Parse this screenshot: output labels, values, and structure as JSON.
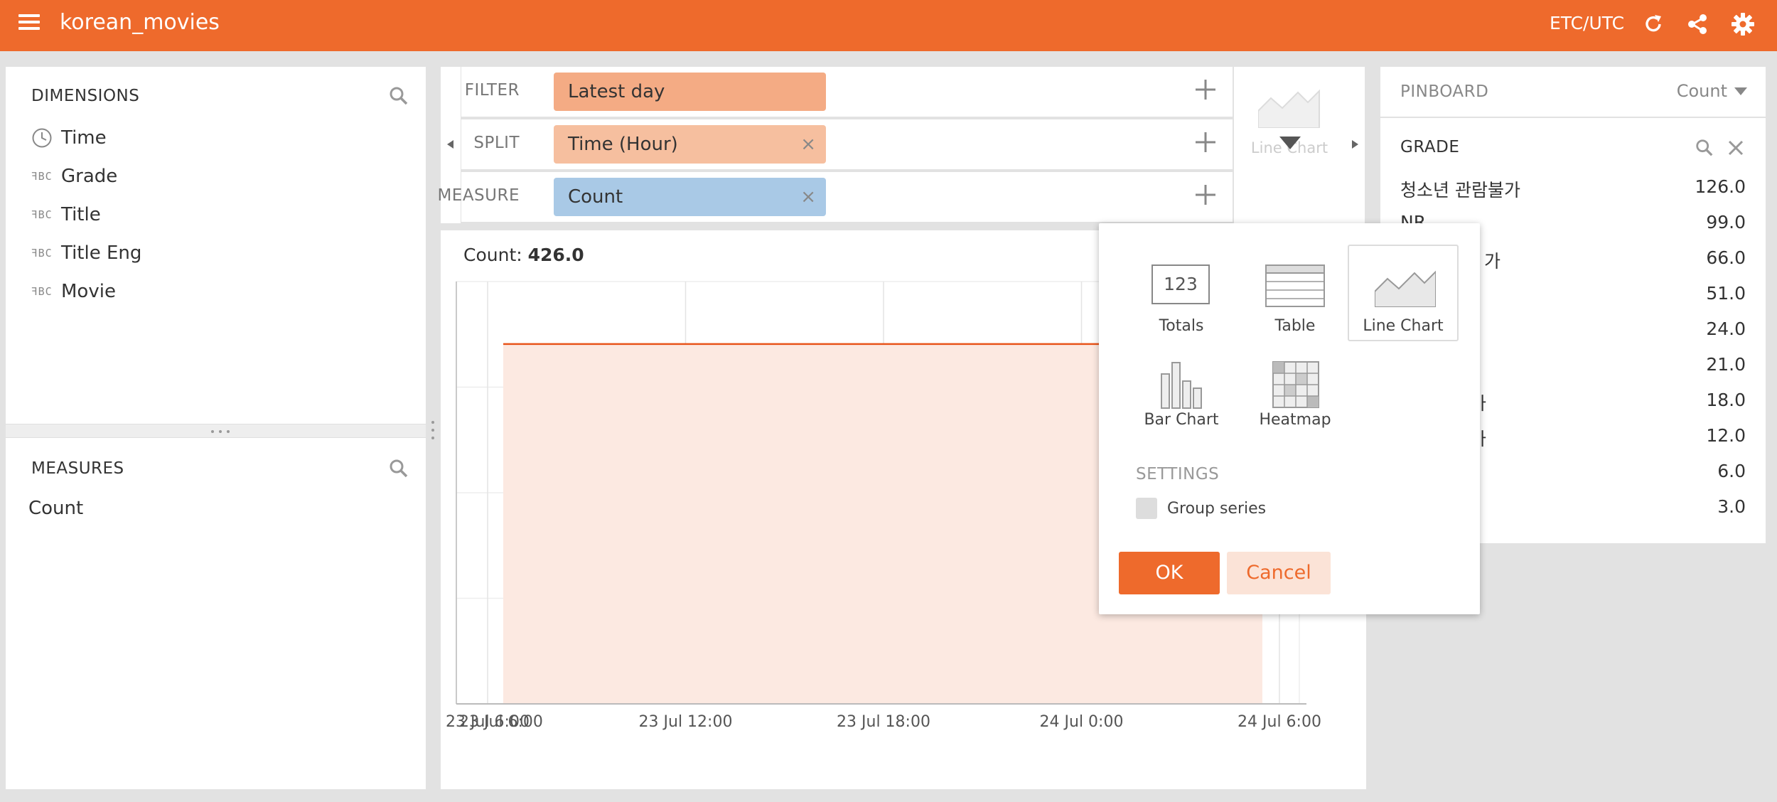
{
  "header": {
    "app_title": "korean_movies",
    "timezone": "ETC/UTC",
    "icons": [
      "menu-icon",
      "refresh-icon",
      "share-icon",
      "settings-icon"
    ]
  },
  "dimensions": {
    "heading": "DIMENSIONS",
    "items": [
      {
        "label": "Time",
        "icon": "clock-icon"
      },
      {
        "label": "Grade",
        "icon": "string-type-icon"
      },
      {
        "label": "Title",
        "icon": "string-type-icon"
      },
      {
        "label": "Title Eng",
        "icon": "string-type-icon"
      },
      {
        "label": "Movie",
        "icon": "string-type-icon"
      }
    ],
    "type_glyph": "ꟻBC"
  },
  "measures": {
    "heading": "MEASURES",
    "items": [
      {
        "label": "Count"
      }
    ]
  },
  "shelf": {
    "filter": {
      "label": "FILTER",
      "pill": "Latest day"
    },
    "split": {
      "label": "SPLIT",
      "pill": "Time (Hour)"
    },
    "measure": {
      "label": "MEASURE",
      "pill": "Count"
    },
    "remove_glyph": "×"
  },
  "viz_selector": {
    "label": "Line Chart"
  },
  "chart": {
    "title_label": "Count:",
    "title_value": "426.0",
    "line_color": "#e8541a",
    "fill_color": "#fce9e1",
    "chart_data": {
      "type": "area",
      "series": [
        {
          "values": [
            426.0,
            426.0
          ]
        }
      ],
      "x": [
        "23 Jul 6:00",
        "24 Jul 6:00"
      ],
      "xticks": [
        "23 Jul 6:00",
        "23 Jul 12:00",
        "23 Jul 18:00",
        "24 Jul 0:00",
        "24 Jul 6:00"
      ],
      "ylim": [
        0,
        500
      ]
    }
  },
  "pinboard": {
    "heading": "PINBOARD",
    "sort_label": "Count",
    "dimension": "GRADE",
    "rows": [
      {
        "label": "청소년 관람불가",
        "value": "126.0"
      },
      {
        "label": "NR",
        "value": "99.0"
      },
      {
        "label": "가",
        "value": "66.0"
      },
      {
        "label": "",
        "value": "51.0"
      },
      {
        "label": "",
        "value": "24.0"
      },
      {
        "label": "",
        "value": "21.0"
      },
      {
        "label": "가",
        "value": "18.0"
      },
      {
        "label": "가",
        "value": "12.0"
      },
      {
        "label": "",
        "value": "6.0"
      },
      {
        "label": "",
        "value": "3.0"
      }
    ]
  },
  "viz_popup": {
    "options": [
      {
        "label": "Totals",
        "icon": "totals-icon",
        "glyph": "123",
        "selected": false
      },
      {
        "label": "Table",
        "icon": "table-icon",
        "selected": false
      },
      {
        "label": "Line Chart",
        "icon": "line-chart-icon",
        "selected": true
      },
      {
        "label": "Bar Chart",
        "icon": "bar-chart-icon",
        "selected": false
      },
      {
        "label": "Heatmap",
        "icon": "heatmap-icon",
        "selected": false
      }
    ],
    "settings_heading": "SETTINGS",
    "group_series_label": "Group series",
    "group_series_checked": false,
    "ok_label": "OK",
    "cancel_label": "Cancel"
  },
  "colors": {
    "brand": "#ee6a2c",
    "filter_pill": "#f4ab84",
    "split_pill": "#f6bf9f",
    "measure_pill": "#a9c9e6"
  }
}
